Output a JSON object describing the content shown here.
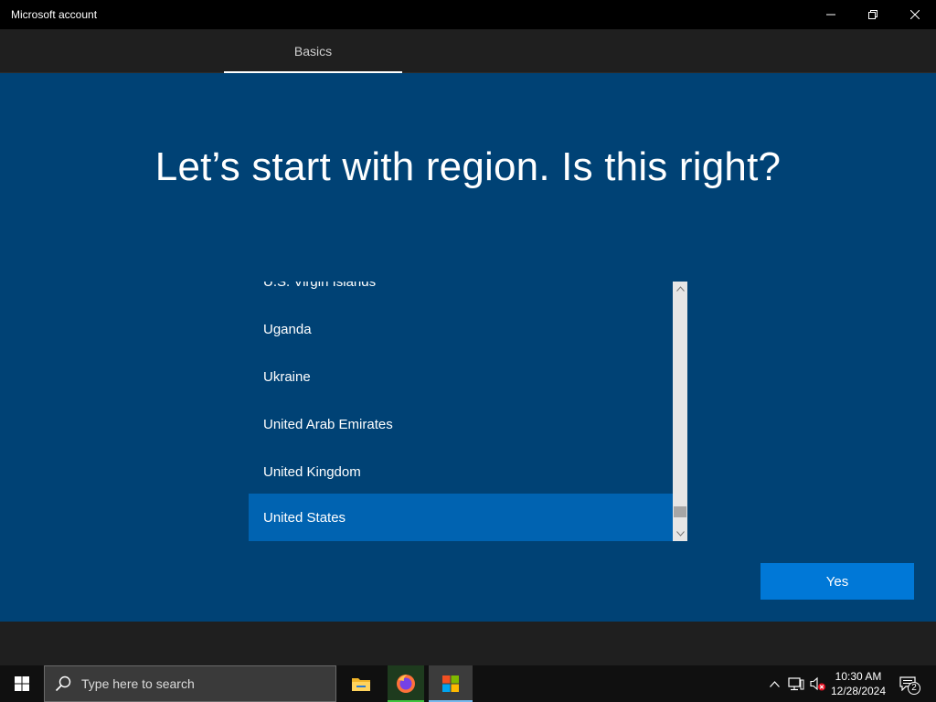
{
  "window": {
    "title": "Microsoft account"
  },
  "tabs": [
    {
      "label": "Basics",
      "active": true
    }
  ],
  "page": {
    "heading": "Let’s start with region. Is this right?"
  },
  "regions": [
    {
      "label": "U.S. Virgin Islands",
      "selected": false
    },
    {
      "label": "Uganda",
      "selected": false
    },
    {
      "label": "Ukraine",
      "selected": false
    },
    {
      "label": "United Arab Emirates",
      "selected": false
    },
    {
      "label": "United Kingdom",
      "selected": false
    },
    {
      "label": "United States",
      "selected": true
    }
  ],
  "actions": {
    "yes_label": "Yes"
  },
  "taskbar": {
    "search_placeholder": "Type here to search",
    "apps": [
      {
        "name": "File Explorer",
        "icon": "folder-icon"
      },
      {
        "name": "Firefox",
        "icon": "firefox-icon"
      },
      {
        "name": "Microsoft Store",
        "icon": "store-icon"
      }
    ],
    "clock_time": "10:30 AM",
    "clock_date": "12/28/2024",
    "notification_count": "2"
  },
  "colors": {
    "background": "#004275",
    "selected_item": "#0063b1",
    "primary_button": "#0078d7"
  }
}
